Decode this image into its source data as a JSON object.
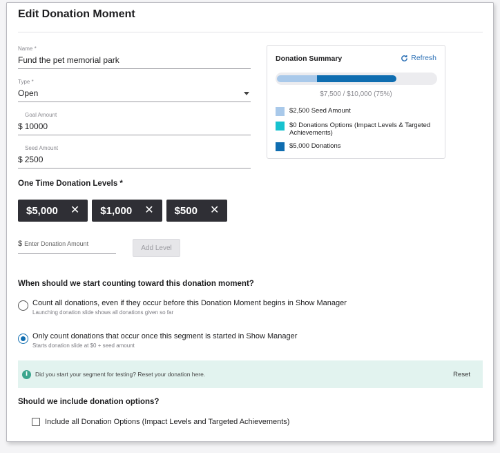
{
  "page": {
    "title": "Edit Donation Moment"
  },
  "form": {
    "name_label": "Name *",
    "name_value": "Fund the pet memorial park",
    "type_label": "Type *",
    "type_value": "Open",
    "goal_label": "Goal Amount",
    "goal_currency": "$",
    "goal_value": "10000",
    "seed_label": "Seed Amount",
    "seed_currency": "$",
    "seed_value": "2500"
  },
  "summary": {
    "title": "Donation Summary",
    "refresh_label": "Refresh",
    "progress_text": "$7,500 / $10,000 (75%)",
    "progress_fraction": 0.75,
    "seed_fraction": 0.25,
    "donations_fraction": 0.5,
    "legend": [
      {
        "label": "$2,500 Seed Amount",
        "color": "#a9c9ea"
      },
      {
        "label": "$0 Donations Options (Impact Levels & Targeted Achievements)",
        "color": "#17c2cf"
      },
      {
        "label": "$5,000 Donations",
        "color": "#0f6db0"
      }
    ]
  },
  "levels": {
    "heading": "One Time Donation Levels *",
    "chips": [
      "$5,000",
      "$1,000",
      "$500"
    ],
    "remove_glyph": "✕",
    "input_currency": "$",
    "input_placeholder": "Enter Donation Amount",
    "add_button": "Add Level"
  },
  "counting": {
    "heading": "When should we start counting toward this donation moment?",
    "options": [
      {
        "label": "Count all donations, even if they occur before this Donation Moment begins in Show Manager",
        "sub": "Launching donation slide shows all donations given so far",
        "selected": false
      },
      {
        "label": "Only count donations that occur once this segment is started in Show Manager",
        "sub": "Starts donation slide at $0 + seed amount",
        "selected": true
      }
    ]
  },
  "banner": {
    "icon": "i",
    "text": "Did you start your segment for testing? Reset your donation here.",
    "reset_label": "Reset"
  },
  "options_section": {
    "heading": "Should we include donation options?",
    "checkbox_label": "Include all Donation Options (Impact Levels and Targeted Achievements)",
    "checked": false
  }
}
